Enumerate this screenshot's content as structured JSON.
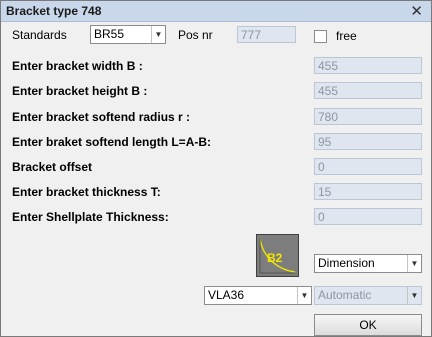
{
  "window": {
    "title": "Bracket type 748",
    "close_glyph": "✕"
  },
  "standards": {
    "label": "Standards",
    "value": "BR55"
  },
  "pos_nr": {
    "label": "Pos nr",
    "value": "777"
  },
  "free": {
    "label": "free",
    "checked": false
  },
  "params": [
    {
      "label": "Enter bracket width B :",
      "value": "455"
    },
    {
      "label": "Enter bracket height B :",
      "value": "455"
    },
    {
      "label": "Enter bracket softend radius r :",
      "value": "780"
    },
    {
      "label": "Enter braket softend length L=A-B:",
      "value": "95"
    },
    {
      "label": "Bracket offset",
      "value": "0"
    },
    {
      "label": "Enter bracket thickness T:",
      "value": "15"
    },
    {
      "label": "Enter Shellplate Thickness:",
      "value": "0"
    }
  ],
  "preview": {
    "icon": "bracket-b2-icon",
    "label": "B2",
    "label_color": "#f2e600",
    "curve_color": "#f2e600"
  },
  "dimension_select": {
    "value": "Dimension"
  },
  "material_select": {
    "value": "VLA36"
  },
  "mode_select": {
    "value": "Automatic"
  },
  "ok_button": {
    "label": "OK"
  }
}
